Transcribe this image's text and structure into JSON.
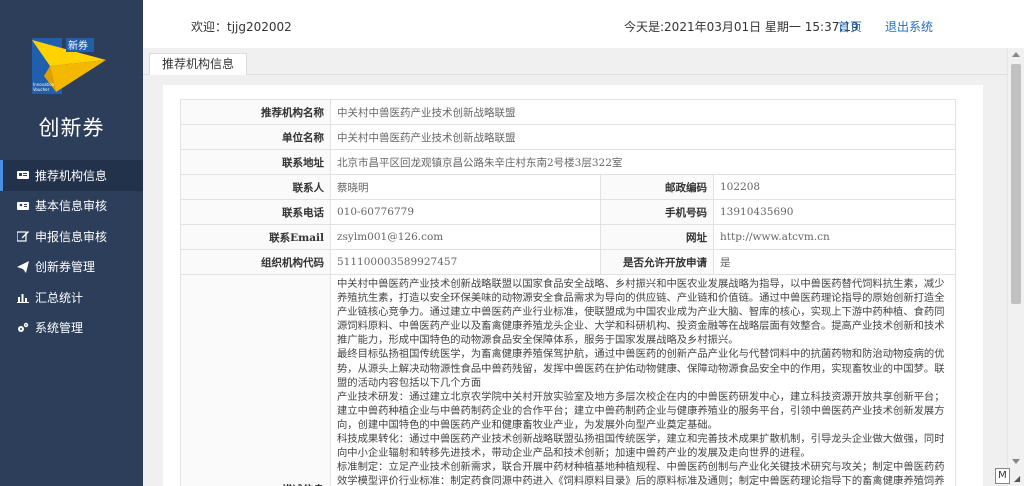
{
  "app": {
    "brand_name": "创新券",
    "logo_text_top": "新券",
    "logo_text_bottom_1": "Innovation",
    "logo_text_bottom_2": "Voucher"
  },
  "header": {
    "welcome": "欢迎：tjjg202002",
    "datetime": "今天是:2021年03月01日 星期一 15:37:19",
    "home_link": "首页",
    "logout_link": "退出系统"
  },
  "sidebar": {
    "items": [
      {
        "label": "推荐机构信息",
        "icon": "id-card-icon"
      },
      {
        "label": "基本信息审核",
        "icon": "address-card-icon"
      },
      {
        "label": "申报信息审核",
        "icon": "edit-icon"
      },
      {
        "label": "创新券管理",
        "icon": "paper-plane-icon"
      },
      {
        "label": "汇总统计",
        "icon": "bar-chart-icon"
      },
      {
        "label": "系统管理",
        "icon": "gears-icon"
      }
    ]
  },
  "tab": {
    "label": "推荐机构信息"
  },
  "form": {
    "org_name_label": "推荐机构名称",
    "org_name_value": "中关村中兽医药产业技术创新战略联盟",
    "unit_name_label": "单位名称",
    "unit_name_value": "中关村中兽医药产业技术创新战略联盟",
    "address_label": "联系地址",
    "address_value": "北京市昌平区回龙观镇京昌公路朱辛庄村东南2号楼3层322室",
    "contact_label": "联系人",
    "contact_value": "蔡晓明",
    "postcode_label": "邮政编码",
    "postcode_value": "102208",
    "phone_label": "联系电话",
    "phone_value": "010-60776779",
    "mobile_label": "手机号码",
    "mobile_value": "13910435690",
    "email_label": "联系Email",
    "email_value": "zsylm001@126.com",
    "website_label": "网址",
    "website_value": "http://www.atcvm.cn",
    "orgcode_label": "组织机构代码",
    "orgcode_value": "511100003589927457",
    "open_apply_label": "是否允许开放申请",
    "open_apply_value": "是",
    "desc_label": "描述信息",
    "desc_text": "中关村中兽医药产业技术创新战略联盟以国家食品安全战略、乡村振兴和中医农业发展战略为指导，以中兽医药替代饲料抗生素，减少养殖抗生素，打造以安全环保美味的动物源安全食品需求为导向的供应链、产业链和价值链。通过中兽医药理论指导的原始创新打造全产业链核心竞争力。通过建立中兽医药产业行业标准，使联盟成为中国农业成为产业大脑、智库的核心，实现上下游中药种植、食药同源饲料原料、中兽医药产业以及畜禽健康养殖龙头企业、大学和科研机构、投资金融等在战略层面有效整合。提高产业技术创新和技术推广能力，形成中国特色的动物源食品安全保障体系，服务于国家发展战略及乡村振兴。\n最终目标弘扬祖国传统医学，为畜禽健康养殖保驾护航，通过中兽医药的创新产品产业化与代替饲料中的抗菌药物和防治动物疫病的优势，从源头上解决动物源性食品中兽药残留，发挥中兽医药在护佑动物健康、保障动物源食品安全中的作用，实现畜牧业的中国梦。联盟的活动内容包括以下几个方面\n产业技术研发：通过建立北京农学院中关村开放实验室及地方多层次校企在内的中兽医药研发中心，建立科技资源开放共享创新平台；建立中兽药种植企业与中兽药制药企业的合作平台；建立中兽药制药企业与健康养殖业的服务平台，引领中兽医药产业技术创新发展方向，创建中国特色的中兽医药产业和健康畜牧业产业，为发展外向型产业奠定基础。\n科技成果转化：通过中兽医药产业技术创新战略联盟弘扬祖国传统医学，建立和完善技术成果扩散机制，引导龙头企业做大做强，同时向中小企业辐射和转移先进技术，带动企业产品和技术创新；加速中兽药产业的发展及走向世界的进程。\n标准制定：立足产业技术创新需求，联合开展中药材种植基地种植规程、中兽医药创制与产业化关键技术研究与攻关；制定中兽医药药效学模型评价行业标准：制定药食同源中药进入《饲料原料目录》后的原料标准及通则；制定中兽医药理论指导下的畜禽健康养殖饲养规程。"
  },
  "colors": {
    "sidebar_bg": "#2c3e5a",
    "sidebar_active_bg": "#22324b",
    "accent": "#4a90e2",
    "link": "#2a6db5",
    "logo_yellow": "#ffd200",
    "logo_blue": "#1f5fae"
  }
}
